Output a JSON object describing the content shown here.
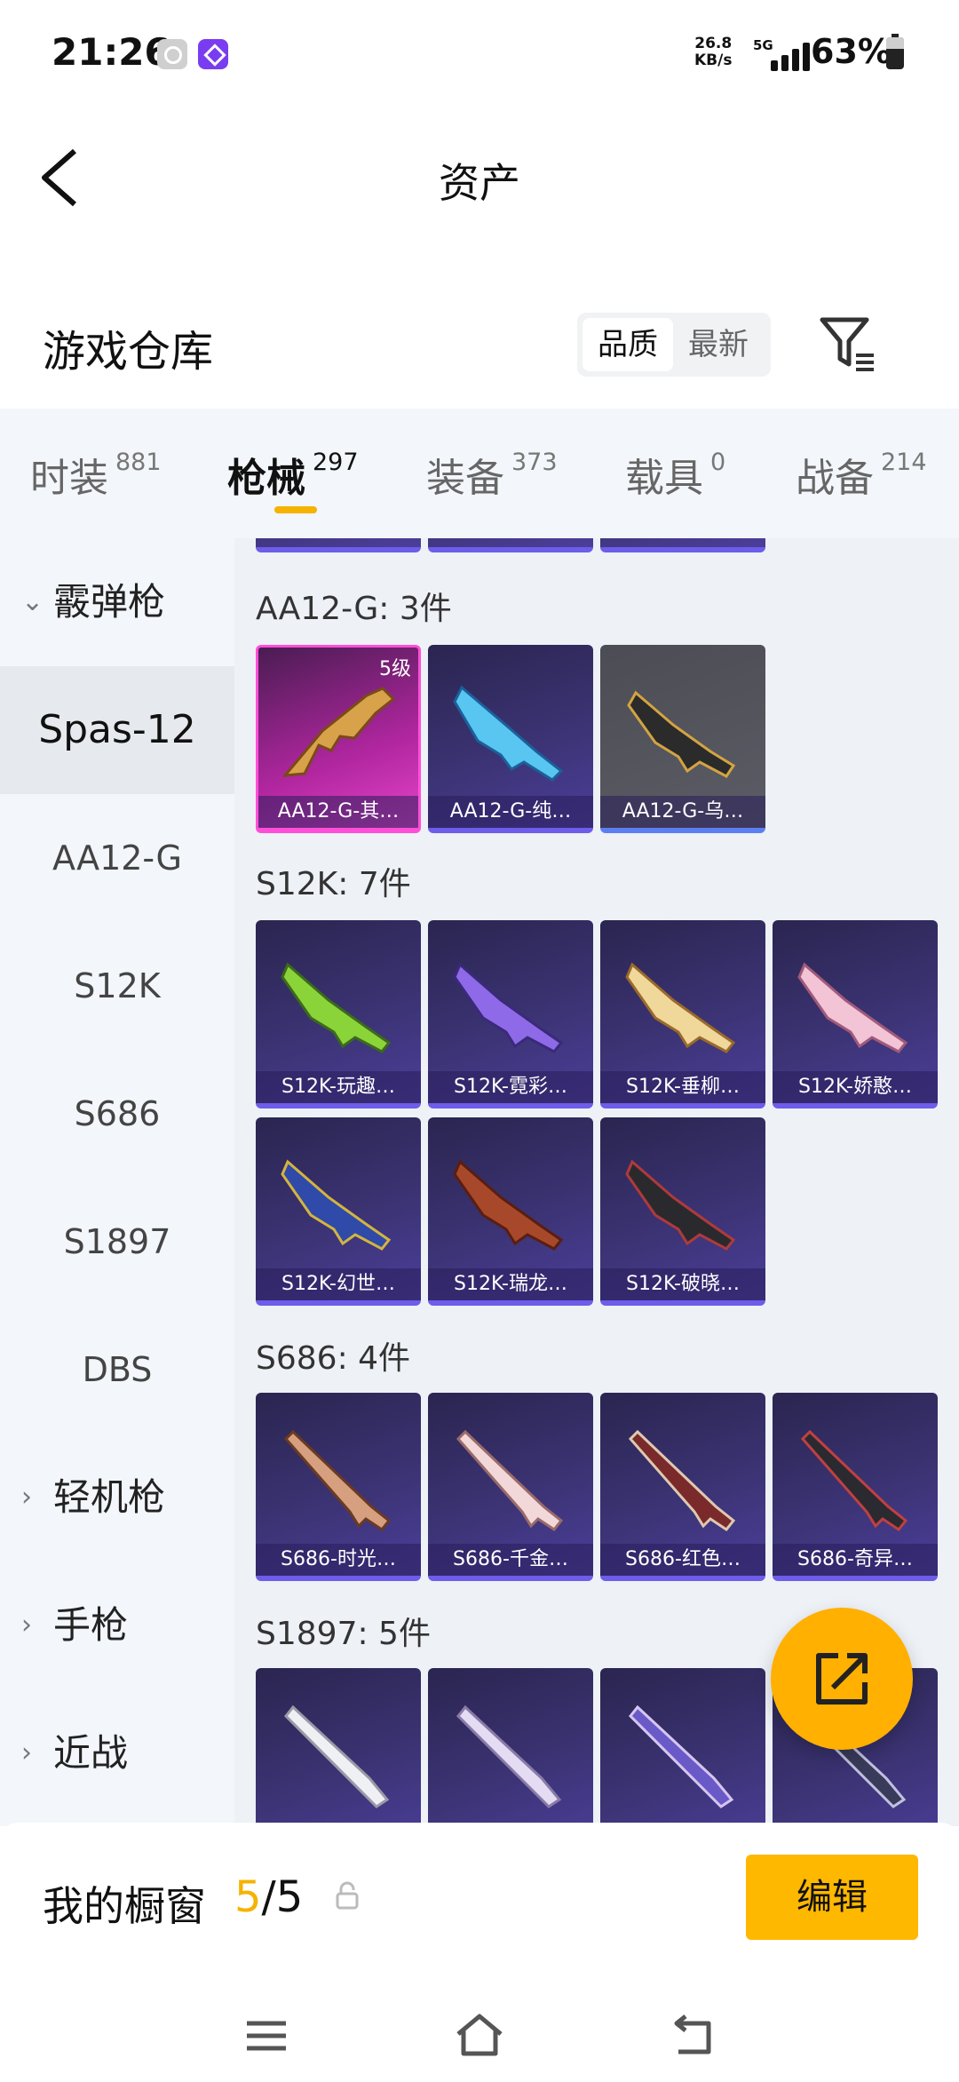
{
  "status_bar": {
    "time": "21:26",
    "speed_value": "26.8",
    "speed_unit": "KB/s",
    "network": "5G",
    "battery": "63%"
  },
  "header": {
    "title": "资产",
    "back_icon": "chevron-left-icon"
  },
  "section": {
    "title": "游戏仓库",
    "sort_options": [
      "品质",
      "最新"
    ],
    "active_sort": "品质",
    "filter_icon": "filter-icon"
  },
  "tabs": [
    {
      "label": "时装",
      "count": "881"
    },
    {
      "label": "枪械",
      "count": "297"
    },
    {
      "label": "装备",
      "count": "373"
    },
    {
      "label": "载具",
      "count": "0"
    },
    {
      "label": "战备",
      "count": "214"
    }
  ],
  "active_tab": "枪械",
  "sidebar": {
    "group_open": "霰弹枪",
    "items": [
      "Spas-12",
      "AA12-G",
      "S12K",
      "S686",
      "S1897",
      "DBS"
    ],
    "selected": "Spas-12",
    "groups_closed": [
      "轻机枪",
      "手枪",
      "近战"
    ]
  },
  "groups": [
    {
      "title": "AA12-G: 3件",
      "items": [
        {
          "name": "AA12-G-其…",
          "level": "5级"
        },
        {
          "name": "AA12-G-纯…"
        },
        {
          "name": "AA12-G-乌…"
        }
      ]
    },
    {
      "title": "S12K: 7件",
      "items": [
        {
          "name": "S12K-玩趣…"
        },
        {
          "name": "S12K-霓彩…"
        },
        {
          "name": "S12K-垂柳…"
        },
        {
          "name": "S12K-娇憨…"
        },
        {
          "name": "S12K-幻世…"
        },
        {
          "name": "S12K-瑞龙…"
        },
        {
          "name": "S12K-破晓…"
        }
      ]
    },
    {
      "title": "S686: 4件",
      "items": [
        {
          "name": "S686-时光…"
        },
        {
          "name": "S686-千金…"
        },
        {
          "name": "S686-红色…"
        },
        {
          "name": "S686-奇异…"
        }
      ]
    },
    {
      "title": "S1897: 5件",
      "items": []
    }
  ],
  "showcase": {
    "label": "我的橱窗",
    "current": "5",
    "total": "/5",
    "edit_label": "编辑"
  },
  "colors": {
    "accent": "#ffb800",
    "card_purple": "#3b3373",
    "card_pink": "#e545c8"
  }
}
